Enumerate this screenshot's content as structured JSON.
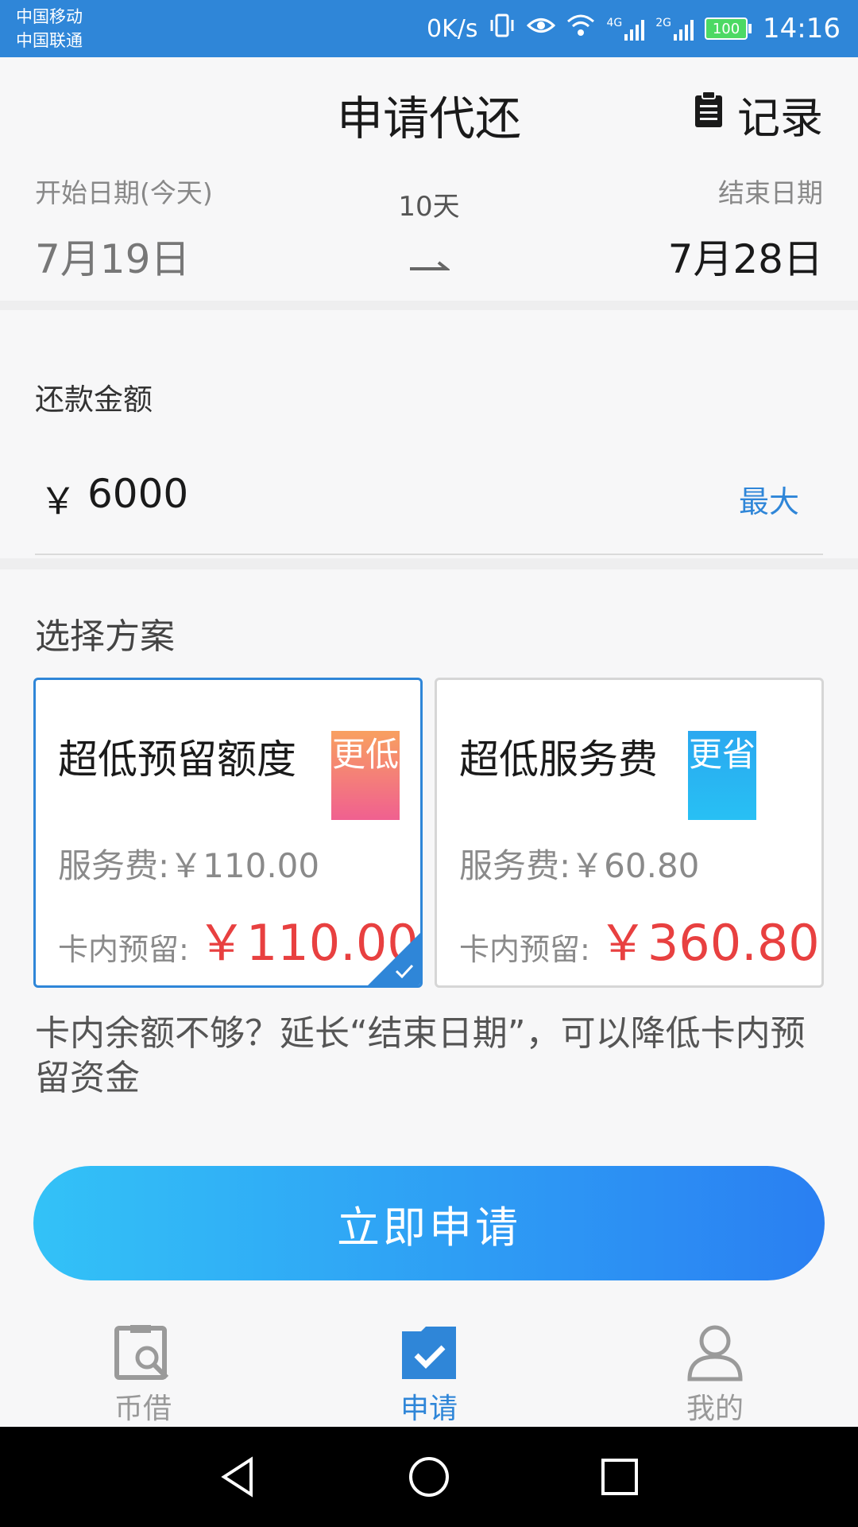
{
  "status_bar": {
    "carrier_1": "中国移动",
    "carrier_2": "中国联通",
    "net_speed": "0K/s",
    "net_4g": "4G",
    "net_2g": "2G",
    "battery": "100",
    "time": "14:16"
  },
  "header": {
    "title": "申请代还",
    "records_label": "记录",
    "records_icon": "clipboard-icon"
  },
  "dates": {
    "start_label": "开始日期(今天)",
    "start_date": "7月19日",
    "duration": "10天",
    "end_label": "结束日期",
    "end_date": "7月28日"
  },
  "amount": {
    "label": "还款金额",
    "currency": "￥",
    "value": "6000",
    "max_label": "最大"
  },
  "plans": {
    "title": "选择方案",
    "items": [
      {
        "name": "超低预留额度",
        "tag": "更低",
        "fee": "服务费:￥110.00",
        "reserve_label": "卡内预留:",
        "reserve_value": "￥110.00",
        "selected": true
      },
      {
        "name": "超低服务费",
        "tag": "更省",
        "fee": "服务费:￥60.80",
        "reserve_label": "卡内预留:",
        "reserve_value": "￥360.80",
        "selected": false
      }
    ]
  },
  "hint": "卡内余额不够？延长“结束日期”，可以降低卡内预留资金",
  "apply_button": "立即申请",
  "tabs": [
    {
      "label": "币借",
      "icon": "search-document-icon",
      "active": false
    },
    {
      "label": "申请",
      "icon": "folder-check-icon",
      "active": true
    },
    {
      "label": "我的",
      "icon": "user-icon",
      "active": false
    }
  ],
  "colors": {
    "accent": "#2f86d8",
    "price_red": "#e84040",
    "button_gradient_start": "#33c2f7",
    "button_gradient_end": "#2a7ff2"
  }
}
